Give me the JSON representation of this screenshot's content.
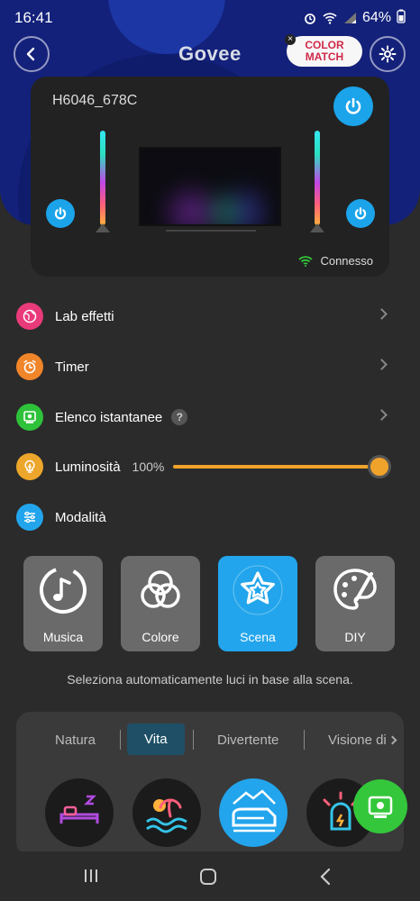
{
  "status": {
    "time": "16:41",
    "battery": "64%"
  },
  "header": {
    "brand": "Govee",
    "badge_line1": "COLOR",
    "badge_line2": "MATCH"
  },
  "device": {
    "name": "H6046_678C",
    "connection": "Connesso"
  },
  "menu": [
    {
      "label": "Lab effetti",
      "color": "#e93a7a",
      "icon": "globe-icon"
    },
    {
      "label": "Timer",
      "color": "#f0852a",
      "icon": "alarm-clock-icon"
    },
    {
      "label": "Elenco istantanee",
      "color": "#2ec23a",
      "icon": "snapshot-icon"
    },
    {
      "label": "Luminosità",
      "color": "#eca62b",
      "icon": "bulb-icon",
      "value": "100%",
      "level": 1.0
    },
    {
      "label": "Modalità",
      "color": "#22a5ec",
      "icon": "sliders-icon"
    }
  ],
  "modes": [
    {
      "label": "Musica",
      "icon": "music-note-icon",
      "active": false
    },
    {
      "label": "Colore",
      "icon": "color-circles-icon",
      "active": false
    },
    {
      "label": "Scena",
      "icon": "star-icon",
      "active": true
    },
    {
      "label": "DIY",
      "icon": "palette-icon",
      "active": false
    }
  ],
  "hint": "Seleziona automaticamente luci in base alla scena.",
  "tabs": [
    {
      "label": "Natura",
      "active": false
    },
    {
      "label": "Vita",
      "active": true
    },
    {
      "label": "Divertente",
      "active": false
    },
    {
      "label": "Visione di",
      "active": false
    }
  ],
  "scenes": [
    {
      "icon": "bed-icon",
      "active": false
    },
    {
      "icon": "palm-beach-icon",
      "active": false
    },
    {
      "icon": "train-icon",
      "active": true
    },
    {
      "icon": "alarm-light-icon",
      "active": false
    }
  ],
  "colors": {
    "accent": "#22a5ec",
    "brightness": "#f0a32a",
    "snapshot_fab": "#34c73b"
  }
}
